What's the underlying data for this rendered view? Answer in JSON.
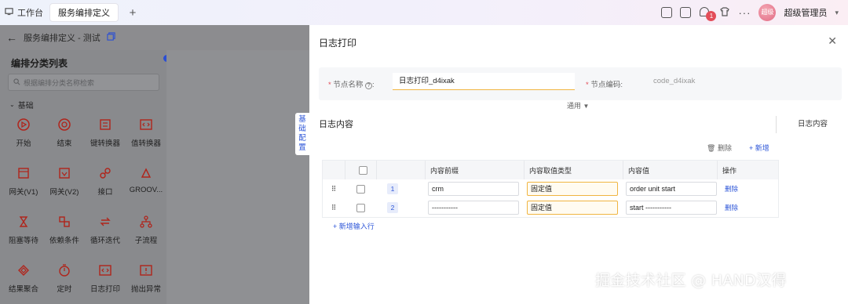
{
  "topbar": {
    "home_tab": "工作台",
    "active_tab": "服务编排定义",
    "add_tab": "+",
    "notification_count": "1",
    "more": "···",
    "avatar_text": "超级",
    "user_name": "超级管理员"
  },
  "left": {
    "back_title": "服务编排定义 - 测试",
    "sidebar_title": "编排分类列表",
    "search_placeholder": "根据编排分类名称检索",
    "group_name": "基础",
    "nodes": [
      {
        "label": "开始",
        "icon": "play-circle-icon"
      },
      {
        "label": "结束",
        "icon": "stop-circle-icon"
      },
      {
        "label": "键转换器",
        "icon": "key-convert-icon"
      },
      {
        "label": "值转换器",
        "icon": "code-brackets-icon"
      },
      {
        "label": "网关(V1)",
        "icon": "gateway-v1-icon"
      },
      {
        "label": "网关(V2)",
        "icon": "gateway-v2-icon"
      },
      {
        "label": "接口",
        "icon": "link-icon"
      },
      {
        "label": "GROOV...",
        "icon": "groovy-icon"
      },
      {
        "label": "阻塞等待",
        "icon": "hourglass-icon"
      },
      {
        "label": "依赖条件",
        "icon": "dependency-icon"
      },
      {
        "label": "循环迭代",
        "icon": "loop-icon"
      },
      {
        "label": "子流程",
        "icon": "subflow-icon"
      },
      {
        "label": "结果聚合",
        "icon": "aggregate-icon"
      },
      {
        "label": "定时",
        "icon": "timer-icon"
      },
      {
        "label": "日志打印",
        "icon": "log-print-icon"
      },
      {
        "label": "抛出异常",
        "icon": "throw-exception-icon"
      }
    ],
    "side_tab": "基础配置"
  },
  "drawer": {
    "title": "日志打印",
    "node_name_label": "节点名称",
    "node_name_value": "日志打印_d4ixak",
    "node_code_label": "节点编码:",
    "node_code_value": "code_d4ixak",
    "advanced_toggle": "通用",
    "section_title": "日志内容",
    "section_right": "日志内容",
    "delete_action": "删除",
    "add_action": "新增",
    "table": {
      "headers": [
        "内容前缀",
        "内容取值类型",
        "内容值",
        "操作"
      ],
      "rows": [
        {
          "index": "1",
          "prefix": "crm",
          "type": "固定值",
          "value": "order unit start",
          "op": "删除"
        },
        {
          "index": "2",
          "prefix": "-----------",
          "type": "固定值",
          "value": "start -----------",
          "op": "删除"
        }
      ]
    },
    "add_row": "新增输入行"
  },
  "watermark": "掘金技术社区 @ HAND汉得",
  "colors": {
    "primary": "#2d56d8",
    "required": "#e34d59",
    "highlight_border": "#f0b541",
    "mask": "#8c8c8f"
  }
}
